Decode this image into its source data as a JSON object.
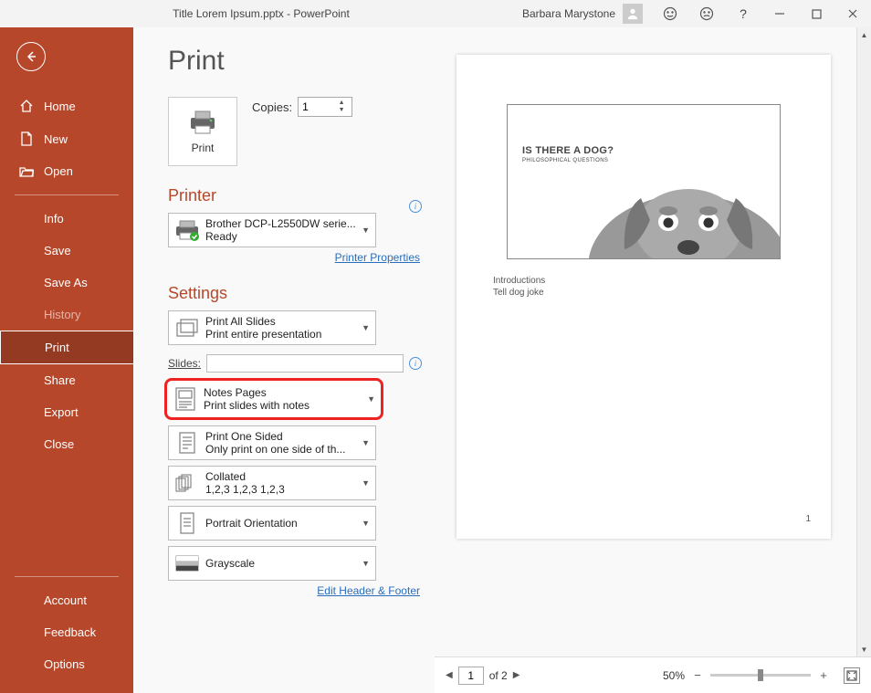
{
  "titlebar": {
    "title": "Title Lorem Ipsum.pptx  -  PowerPoint",
    "user": "Barbara Marystone"
  },
  "sidebar": {
    "home": "Home",
    "new": "New",
    "open": "Open",
    "info": "Info",
    "save": "Save",
    "saveas": "Save As",
    "history": "History",
    "print": "Print",
    "share": "Share",
    "export": "Export",
    "close": "Close",
    "account": "Account",
    "feedback": "Feedback",
    "options": "Options"
  },
  "page": {
    "heading": "Print",
    "printButton": "Print",
    "copiesLabel": "Copies:",
    "copiesValue": "1",
    "printerHeading": "Printer",
    "printer": {
      "name": "Brother DCP-L2550DW serie...",
      "status": "Ready"
    },
    "printerPropsLink": "Printer Properties",
    "settingsHeading": "Settings",
    "slidesLabel": "Slides:",
    "editHeaderFooter": "Edit Header & Footer",
    "settings": {
      "printAll": {
        "t1": "Print All Slides",
        "t2": "Print entire presentation"
      },
      "notesPages": {
        "t1": "Notes Pages",
        "t2": "Print slides with notes"
      },
      "oneSided": {
        "t1": "Print One Sided",
        "t2": "Only print on one side of th..."
      },
      "collated": {
        "t1": "Collated",
        "t2": "1,2,3    1,2,3    1,2,3"
      },
      "orientation": {
        "t1": "Portrait Orientation"
      },
      "grayscale": {
        "t1": "Grayscale"
      }
    }
  },
  "preview": {
    "slideTitle": "IS THERE A DOG?",
    "slideSub": "PHILOSOPHICAL QUESTIONS",
    "notes": [
      "Introductions",
      "Tell dog joke"
    ],
    "pageNumber": "1"
  },
  "footer": {
    "currentPage": "1",
    "ofLabel": "of 2",
    "zoomPct": "50%"
  }
}
